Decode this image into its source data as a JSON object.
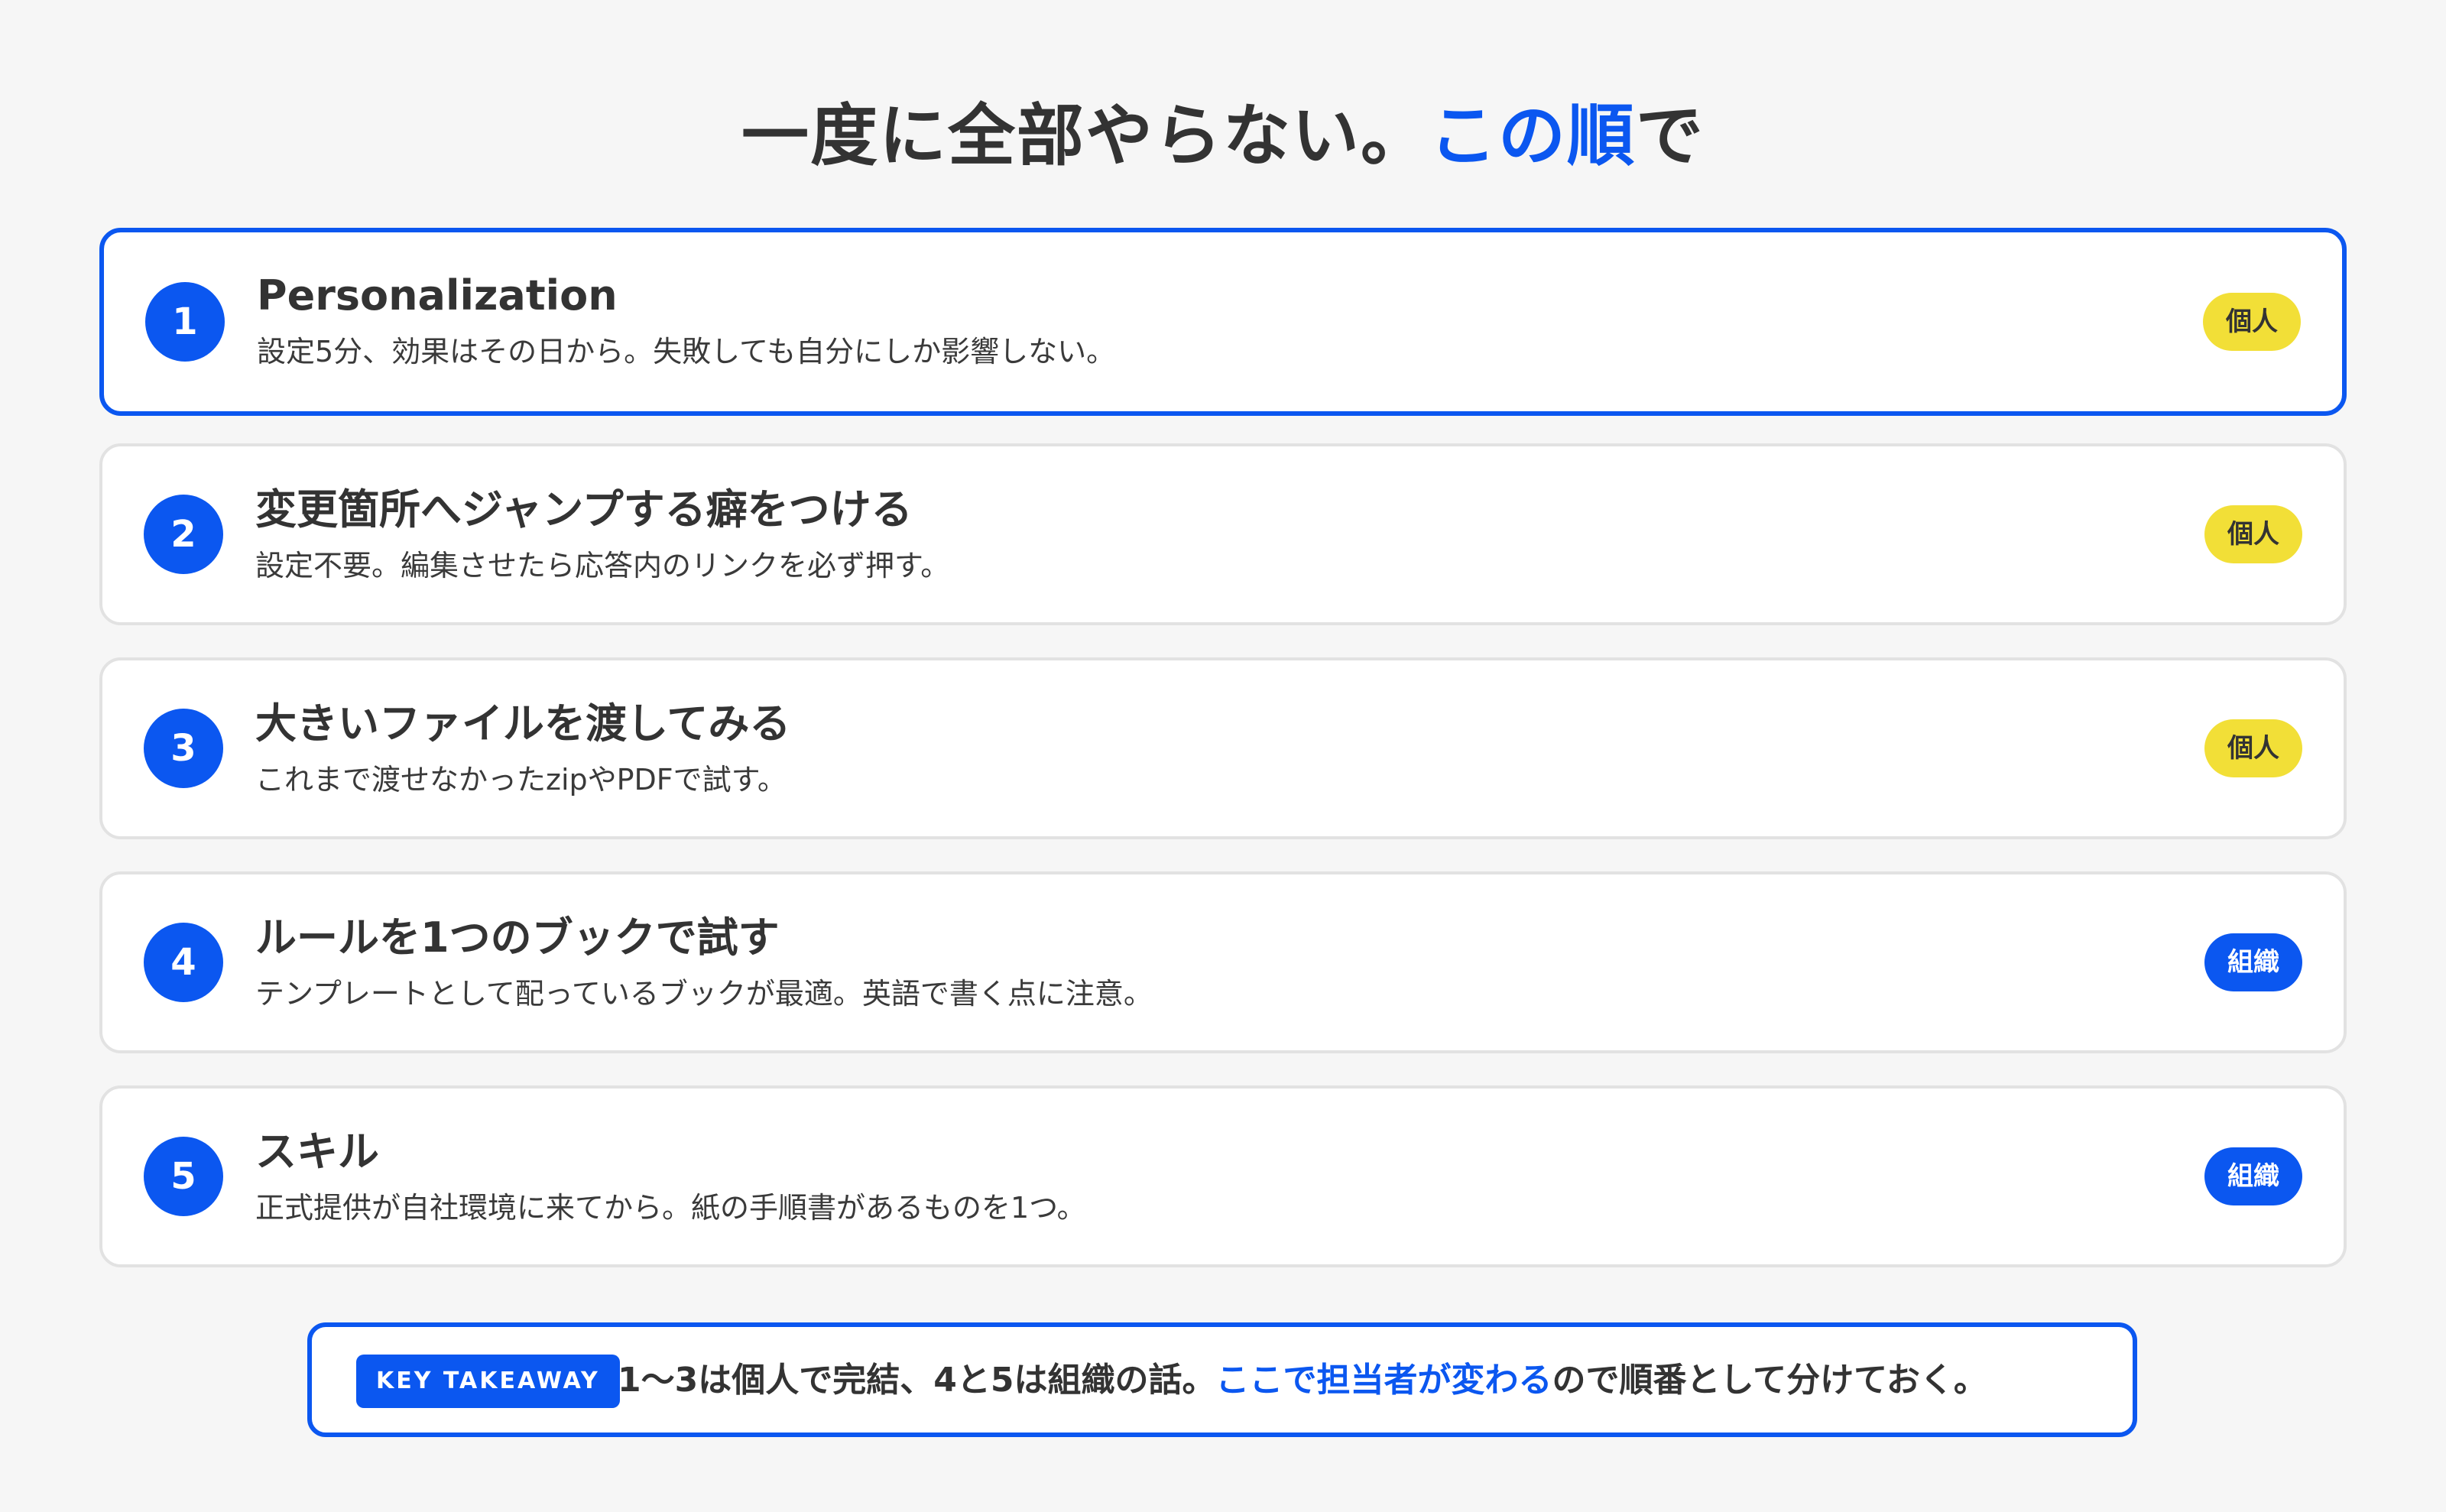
{
  "title": {
    "prefix": "一度に全部やらない。",
    "highlight": "この順",
    "suffix": "で"
  },
  "steps": [
    {
      "number": "1",
      "title": "Personalization",
      "description": "設定5分、効果はその日から。失敗しても自分にしか影響しない。",
      "badge": "個人"
    },
    {
      "number": "2",
      "title": "変更箇所へジャンプする癖をつける",
      "description": "設定不要。編集させたら応答内のリンクを必ず押す。",
      "badge": "個人"
    },
    {
      "number": "3",
      "title": "大きいファイルを渡してみる",
      "description": "これまで渡せなかったzipやPDFで試す。",
      "badge": "個人"
    },
    {
      "number": "4",
      "title": "ルールを1つのブックで試す",
      "description": "テンプレートとして配っているブックが最適。英語で書く点に注意。",
      "badge": "組織"
    },
    {
      "number": "5",
      "title": "スキル",
      "description": "正式提供が自社環境に来てから。紙の手順書があるものを1つ。",
      "badge": "組織"
    }
  ],
  "takeaway": {
    "label": "KEY TAKEAWAY",
    "text_before": "1〜3は個人で完結、4と5は組織の話。",
    "text_highlight": "ここで担当者が変わる",
    "text_after": "ので順番として分けておく。"
  },
  "colors": {
    "accent": "#0b57f0",
    "personal_badge": "#f2df37",
    "background": "#f6f6f6"
  }
}
